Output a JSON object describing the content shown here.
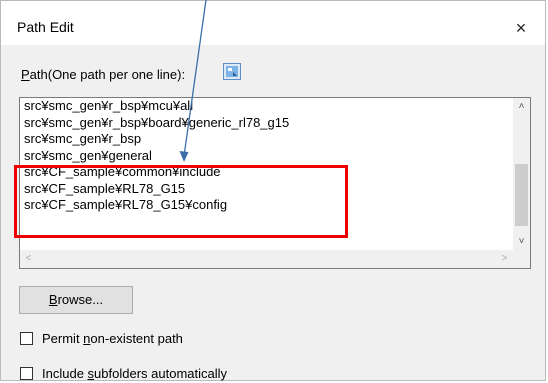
{
  "window": {
    "title": "Path Edit",
    "close_glyph": "×"
  },
  "path_label": {
    "accel_char": "P",
    "rest": "ath(One path per one line):"
  },
  "paths": [
    "src¥smc_gen¥r_bsp¥mcu¥all",
    "src¥smc_gen¥r_bsp¥board¥generic_rl78_g15",
    "src¥smc_gen¥r_bsp",
    "src¥smc_gen¥general",
    "src¥CF_sample¥common¥include",
    "src¥CF_sample¥RL78_G15",
    "src¥CF_sample¥RL78_G15¥config"
  ],
  "browse_button": {
    "accel_char": "B",
    "rest": "rowse..."
  },
  "checkboxes": [
    {
      "pre": "Permit ",
      "accel_char": "n",
      "post": "on-existent path",
      "checked": false
    },
    {
      "pre": "Include ",
      "accel_char": "s",
      "post": "ubfolders automatically",
      "checked": false
    }
  ],
  "annotation": {
    "highlight_color": "#ee0000",
    "arrow_color": "#3c6ea8"
  },
  "icons": {
    "help": "help-icon",
    "close": "close-icon",
    "scroll_up": "scroll-up-icon",
    "scroll_down": "scroll-down-icon",
    "scroll_left": "scroll-left-icon",
    "scroll_right": "scroll-right-icon"
  }
}
